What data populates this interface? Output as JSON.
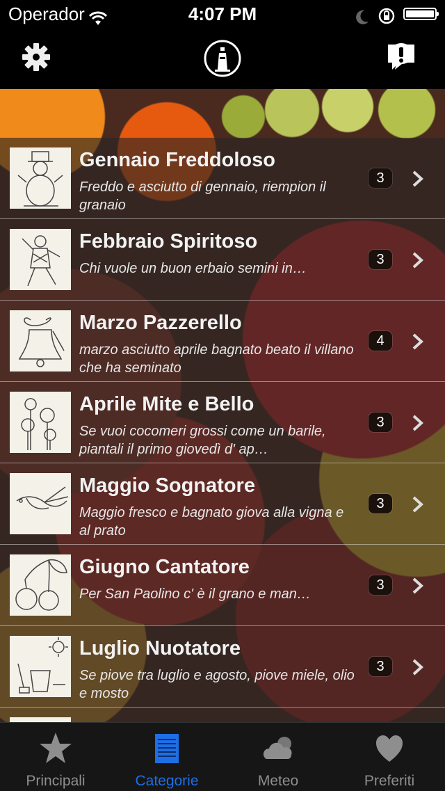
{
  "status_bar": {
    "carrier": "Operador",
    "time": "4:07 PM"
  },
  "nav": {
    "settings_icon": "gear-icon",
    "logo_icon": "lighthouse-icon",
    "feedback_icon": "alert-bubble-icon"
  },
  "items": [
    {
      "title": "Gennaio Freddoloso",
      "subtitle": "Freddo e asciutto di gennaio, riempion il granaio",
      "count": "3"
    },
    {
      "title": "Febbraio Spiritoso",
      "subtitle": "Chi vuole un buon erbaio semini in…",
      "count": "3"
    },
    {
      "title": "Marzo Pazzerello",
      "subtitle": "marzo asciutto aprile bagnato beato il villano che ha seminato",
      "count": "4"
    },
    {
      "title": "Aprile Mite e Bello",
      "subtitle": "Se vuoi cocomeri grossi come un barile, piantali il primo giovedì d' ap…",
      "count": "3"
    },
    {
      "title": "Maggio Sognatore",
      "subtitle": "Maggio fresco e bagnato giova alla vigna e al prato",
      "count": "3"
    },
    {
      "title": "Giugno Cantatore",
      "subtitle": "Per San Paolino c' è il grano e man…",
      "count": "3"
    },
    {
      "title": "Luglio Nuotatore",
      "subtitle": "Se piove tra luglio e agosto, piove miele, olio e mosto",
      "count": "3"
    }
  ],
  "tabs": [
    {
      "label": "Principali",
      "icon": "star-icon"
    },
    {
      "label": "Categorie",
      "icon": "list-icon"
    },
    {
      "label": "Meteo",
      "icon": "cloud-icon"
    },
    {
      "label": "Preferiti",
      "icon": "heart-icon"
    }
  ],
  "colors": {
    "tab_active": "#1e6ee6",
    "tab_inactive": "#8e8e8e"
  }
}
